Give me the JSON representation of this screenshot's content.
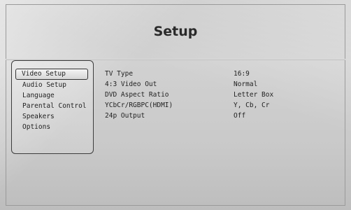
{
  "page": {
    "title": "Setup"
  },
  "menu": {
    "items": [
      {
        "label": "Video Setup",
        "selected": true
      },
      {
        "label": "Audio Setup",
        "selected": false
      },
      {
        "label": "Language",
        "selected": false
      },
      {
        "label": "Parental Control",
        "selected": false
      },
      {
        "label": "Speakers",
        "selected": false
      },
      {
        "label": "Options",
        "selected": false
      }
    ]
  },
  "settings": [
    {
      "label": "TV Type",
      "value": "16:9"
    },
    {
      "label": "4:3 Video Out",
      "value": "Normal"
    },
    {
      "label": "DVD Aspect Ratio",
      "value": "Letter Box"
    },
    {
      "label": "YCbCr/RGBPC(HDMI)",
      "value": "Y, Cb, Cr"
    },
    {
      "label": "24p Output",
      "value": "Off"
    }
  ]
}
